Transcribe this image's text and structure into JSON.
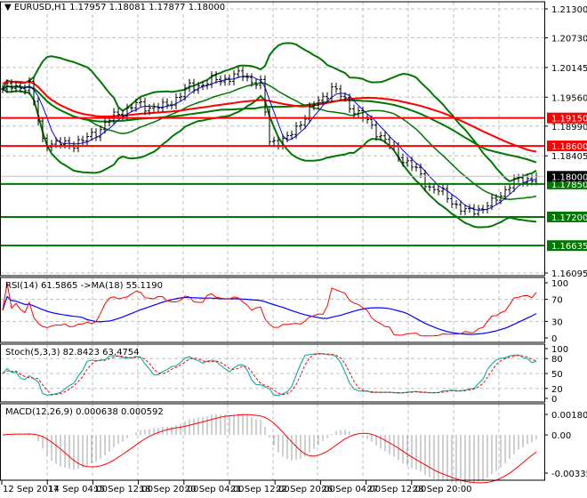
{
  "header": {
    "symbol": "EURUSD,H1",
    "open": "1.17957",
    "high": "1.18081",
    "low": "1.17877",
    "close": "1.18000"
  },
  "chart_data": [
    {
      "type": "line",
      "title": "EURUSD,H1 price with Bollinger Bands and moving averages",
      "ylim": [
        1.16095,
        1.213
      ],
      "price_ticks": [
        "1.21300",
        "1.20730",
        "1.20145",
        "1.19560",
        "1.18990",
        "1.18405",
        "1.16095"
      ],
      "levels": [
        {
          "label": "1.19150",
          "value": 1.1915,
          "color": "#ff0000"
        },
        {
          "label": "1.18600",
          "value": 1.186,
          "color": "#ff0000"
        },
        {
          "label": "1.17850",
          "value": 1.1785,
          "color": "#007700"
        },
        {
          "label": "1.17200",
          "value": 1.172,
          "color": "#007700"
        },
        {
          "label": "1.16635",
          "value": 1.16635,
          "color": "#007700"
        }
      ],
      "current": {
        "label": "1.18000",
        "value": 1.18
      },
      "keypoints": [
        [
          0,
          1.1972
        ],
        [
          6,
          1.198
        ],
        [
          9,
          1.1872
        ],
        [
          12,
          1.1862
        ],
        [
          18,
          1.1868
        ],
        [
          22,
          1.1895
        ],
        [
          26,
          1.1925
        ],
        [
          30,
          1.194
        ],
        [
          36,
          1.1935
        ],
        [
          42,
          1.1975
        ],
        [
          48,
          1.199
        ],
        [
          54,
          1.2
        ],
        [
          58,
          1.198
        ],
        [
          60,
          1.187
        ],
        [
          64,
          1.1872
        ],
        [
          68,
          1.192
        ],
        [
          74,
          1.1975
        ],
        [
          78,
          1.194
        ],
        [
          84,
          1.189
        ],
        [
          88,
          1.185
        ],
        [
          92,
          1.182
        ],
        [
          96,
          1.178
        ],
        [
          100,
          1.176
        ],
        [
          104,
          1.1728
        ],
        [
          110,
          1.1745
        ],
        [
          114,
          1.1785
        ],
        [
          120,
          1.18
        ]
      ],
      "x_labels": [
        "12 Sep 2017",
        "14 Sep 04:00",
        "15 Sep 12:00",
        "18 Sep 20:00",
        "20 Sep 04:00",
        "21 Sep 12:00",
        "22 Sep 20:00",
        "26 Sep 04:00",
        "27 Sep 12:00",
        "28 Sep 20:00"
      ]
    },
    {
      "type": "line",
      "title": "RSI(14) 61.5865  ->MA(18) 55.1190",
      "ylim": [
        0,
        100
      ],
      "ticks": [
        "100",
        "70",
        "30",
        "0"
      ]
    },
    {
      "type": "line",
      "title": "Stoch(5,3,3) 82.8423 63.4754",
      "ylim": [
        0,
        100
      ],
      "ticks": [
        "100",
        "80",
        "50",
        "20",
        "0"
      ]
    },
    {
      "type": "bar",
      "title": "MACD(12,26,9) 0.000638 0.000592",
      "ylim": [
        -0.003357,
        0.001805
      ],
      "ticks": [
        "0.001805",
        "0.00",
        "-0.003357"
      ]
    }
  ]
}
